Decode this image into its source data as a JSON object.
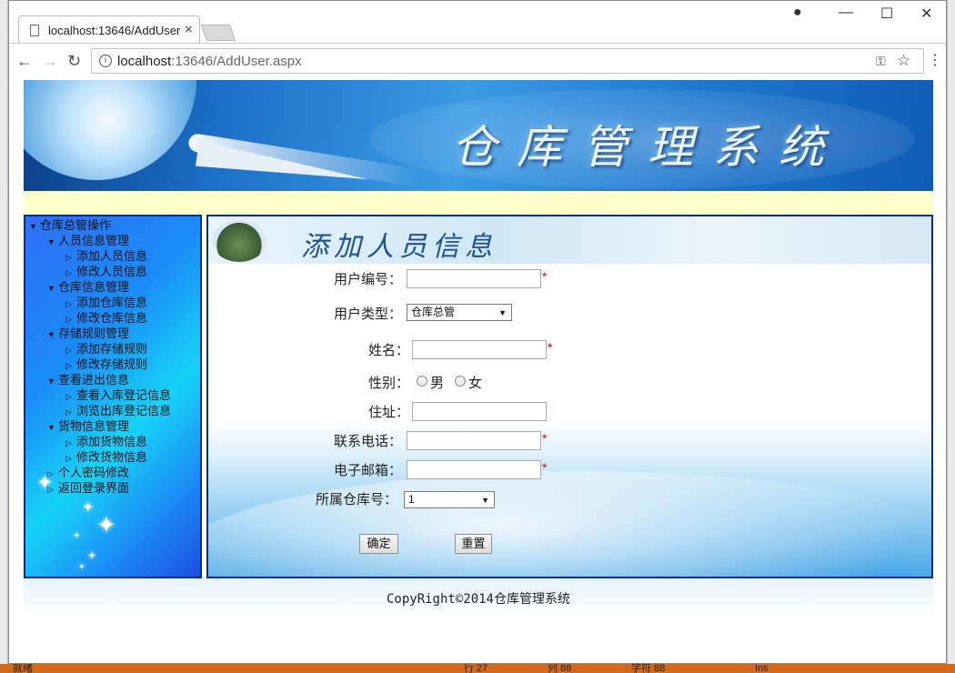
{
  "browser": {
    "tab_title": "localhost:13646/AddUser.aspx",
    "tab_close": "×",
    "url_host": "localhost",
    "url_rest": ":13646/AddUser.aspx"
  },
  "taskbar": {
    "status": "就绪",
    "row": "行 27",
    "col": "列 88",
    "char": "字符 88",
    "ins": "Ins"
  },
  "banner": {
    "title": "仓库管理系统"
  },
  "sidebar": {
    "root": "仓库总管操作",
    "groups": [
      {
        "label": "人员信息管理",
        "items": [
          "添加人员信息",
          "修改人员信息"
        ]
      },
      {
        "label": "仓库信息管理",
        "items": [
          "添加仓库信息",
          "修改仓库信息"
        ]
      },
      {
        "label": "存储规则管理",
        "items": [
          "添加存储规则",
          "修改存储规则"
        ]
      },
      {
        "label": "查看进出信息",
        "items": [
          "查看入库登记信息",
          "浏览出库登记信息"
        ]
      },
      {
        "label": "货物信息管理",
        "items": [
          "添加货物信息",
          "修改货物信息"
        ]
      }
    ],
    "extra": [
      "个人密码修改",
      "返回登录界面"
    ]
  },
  "content": {
    "header_title": "添加人员信息",
    "fields": {
      "user_id_label": "用户编号：",
      "user_type_label": "用户类型：",
      "user_type_value": "仓库总管",
      "name_label": "姓名：",
      "gender_label": "性别：",
      "gender_male": "男",
      "gender_female": "女",
      "address_label": "住址：",
      "phone_label": "联系电话：",
      "email_label": "电子邮箱：",
      "warehouse_label": "所属仓库号：",
      "warehouse_value": "1"
    },
    "required_mark": "*",
    "confirm_label": "确定",
    "reset_label": "重置"
  },
  "footer": {
    "copyright": "CopyRight©2014仓库管理系统"
  }
}
